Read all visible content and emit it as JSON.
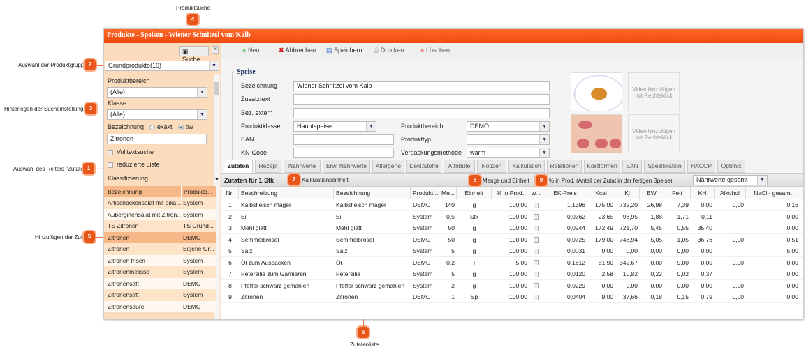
{
  "annotations": {
    "m1": "1",
    "m1_text": "Auswahl des Reiters \"Zutaten\"",
    "m2": "2",
    "m2_text": "Auswahl der Produktgruppe",
    "m3": "3",
    "m3_text": "Hinterlegen der Sucheinstellungen",
    "m4": "4",
    "m4_text": "Produktsuche",
    "m5": "5",
    "m5_text": "Hinzufügen der Zutat",
    "m6": "6",
    "m6_text": "Zutatenliste",
    "m7": "7",
    "m7_text": "Kalkulationseinheit",
    "m8": "8",
    "m8_text": "Menge und Einheit",
    "m9": "9",
    "m9_text": "% in Prod. (Anteil der Zutat in der fertigen Speise)"
  },
  "window": {
    "title": "Produkte - Speisen - Wiener Schnitzel vom Kalb"
  },
  "left": {
    "search_button": "Suche",
    "group": "Grundprodukte(10)",
    "produktbereich_label": "Produktbereich",
    "produktbereich": "(Alle)",
    "klasse_label": "Klasse",
    "klasse": "(Alle)",
    "bezeichnung_label": "Bezeichnung",
    "exakt": "exakt",
    "tlw": "tlw",
    "search_value": "Zitronen",
    "volltext": "Volltextsuche",
    "reduziert": "reduzierte Liste",
    "klassifizierung": "Klassifizierung",
    "columns": [
      "Bezeichnung",
      "Produktb..."
    ],
    "rows": [
      [
        "Artischockensalat mit pika...",
        "System"
      ],
      [
        "Auberginensalat mit Zitron...",
        "System"
      ],
      [
        "TS Zitronen",
        "TS Grund..."
      ],
      [
        "Zitronen",
        "DEMO"
      ],
      [
        "Zitronen",
        "Eigene Gr..."
      ],
      [
        "Zitronen frisch",
        "System"
      ],
      [
        "Zitronenmelisse",
        "System"
      ],
      [
        "Zitronensaft",
        "DEMO"
      ],
      [
        "Zitronensaft",
        "System"
      ],
      [
        "Zitronensäure",
        "DEMO"
      ]
    ],
    "selected_row": 3
  },
  "toolbar": {
    "neu": "Neu",
    "abbrechen": "Abbrechen",
    "speichern": "Speichern",
    "drucken": "Drucken",
    "loeschen": "Löschen"
  },
  "form": {
    "legend": "Speise",
    "bezeichnung_label": "Bezeichnung",
    "bezeichnung": "Wiener Schnitzel vom Kalb",
    "zusatztext_label": "Zusatztext",
    "bezextern_label": "Bez. extern",
    "produktklasse_label": "Produktklasse",
    "produktklasse": "Hauptspeise",
    "produktbereich_label": "Produktbereich",
    "produktbereich": "DEMO",
    "ean_label": "EAN",
    "produkttyp_label": "Produkttyp",
    "kncode_label": "KN-Code",
    "verpackung_label": "Verpackungsmethode",
    "verpackung": "warm",
    "video1": "Video hinzufügen mit Rechtsklick",
    "video2": "Video hinzufügen mit Rechtsklick"
  },
  "tabs": [
    "Zutaten",
    "Rezept",
    "Nährwerte",
    "Erw. Nährwerte",
    "Allergene",
    "Dekl.Stoffe",
    "Attribute",
    "Notizen",
    "Kalkulation",
    "Relationen",
    "Kostformen",
    "EAN",
    "Spezifikation",
    "HACCP",
    "Optimix"
  ],
  "active_tab": 0,
  "grid": {
    "title": "Zutaten für 1 Stk",
    "naehrwerte_select": "Nährwerte gesamt",
    "columns": [
      "Nr.",
      "Beschreibung",
      "Bezeichnung",
      "Produkt...",
      "Me...",
      "Einheit",
      "% in Prod.",
      "w...",
      "EK-Preis",
      "Kcal",
      "Kj",
      "EW",
      "Fett",
      "KH",
      "Alkohol",
      "NaCl - gesamt"
    ],
    "rows": [
      [
        "1",
        "Kalbsfleisch mager",
        "Kalbsfleisch mager",
        "DEMO",
        "140",
        "g",
        "100,00",
        "",
        "1,1396",
        "175,00",
        "732,20",
        "26,98",
        "7,39",
        "0,00",
        "0,00",
        "0,16"
      ],
      [
        "2",
        "Ei",
        "Ei",
        "System",
        "0,5",
        "Stk",
        "100,00",
        "",
        "0,0762",
        "23,65",
        "98,95",
        "1,88",
        "1,71",
        "0,11",
        "",
        "0,00"
      ],
      [
        "3",
        "Mehl glatt",
        "Mehl glatt",
        "System",
        "50",
        "g",
        "100,00",
        "",
        "0,0244",
        "172,49",
        "721,70",
        "5,45",
        "0,55",
        "35,40",
        "",
        "0,00"
      ],
      [
        "4",
        "Semmelbrösel",
        "Semmelbrösel",
        "DEMO",
        "50",
        "g",
        "100,00",
        "",
        "0,0725",
        "179,00",
        "748,94",
        "5,05",
        "1,05",
        "36,76",
        "0,00",
        "0,51"
      ],
      [
        "5",
        "Salz",
        "Salz",
        "System",
        "5",
        "g",
        "100,00",
        "",
        "0,0031",
        "0,00",
        "0,00",
        "0,00",
        "0,00",
        "0,00",
        "",
        "5,00"
      ],
      [
        "6",
        "Öl zum Ausbacken",
        "Öl",
        "DEMO",
        "0.2",
        "l",
        "5,00",
        "",
        "0,1612",
        "81,90",
        "342,67",
        "0,00",
        "9,00",
        "0,00",
        "0,00",
        "0,00"
      ],
      [
        "7",
        "Petersilie zum Garnieren",
        "Petersilie",
        "System",
        "5",
        "g",
        "100,00",
        "",
        "0,0120",
        "2,58",
        "10,82",
        "0,22",
        "0,02",
        "0,37",
        "",
        "0,00"
      ],
      [
        "8",
        "Pfeffer schwarz gemahlen",
        "Pfeffer schwarz gemahlen",
        "System",
        "2",
        "g",
        "100,00",
        "",
        "0,0229",
        "0,00",
        "0,00",
        "0,00",
        "0,00",
        "0,00",
        "0,00",
        "0,00"
      ],
      [
        "9",
        "Zitronen",
        "Zitronen",
        "DEMO",
        "1",
        "Sp",
        "100,00",
        "",
        "0,0404",
        "9,00",
        "37,66",
        "0,18",
        "0,15",
        "0,79",
        "0,00",
        "0,00"
      ]
    ]
  },
  "colors": {
    "accent": "#f04a10",
    "panel": "#fbdcbd",
    "marker": "#e8561a"
  }
}
